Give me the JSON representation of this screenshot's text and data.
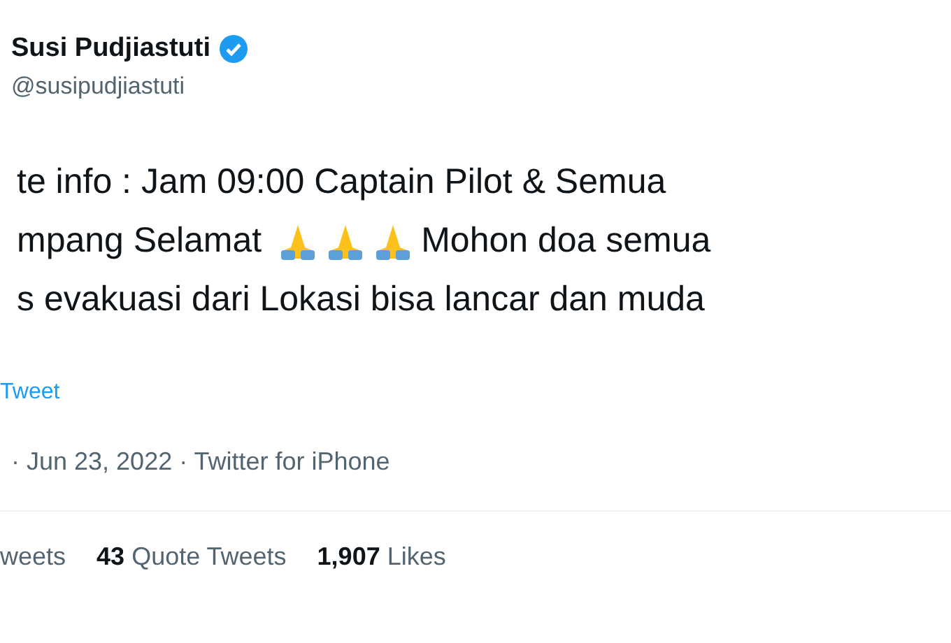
{
  "author": {
    "name": "Susi Pudjiastuti",
    "verified": true,
    "handle": "@susipudjiastuti"
  },
  "tweet_lines": [
    [
      {
        "kind": "text",
        "text": "te info : Jam 09:00 Captain Pilot & Semua"
      }
    ],
    [
      {
        "kind": "text",
        "text": "mpang Selamat"
      },
      {
        "kind": "emoji"
      },
      {
        "kind": "emoji"
      },
      {
        "kind": "emoji"
      },
      {
        "kind": "text",
        "text": "Mohon doa semua"
      }
    ],
    [
      {
        "kind": "text",
        "text": "s evakuasi dari Lokasi bisa lancar dan muda"
      }
    ]
  ],
  "translate_link": "Tweet",
  "meta": "· Jun 23, 2022 · Twitter for iPhone",
  "stats": [
    {
      "label": "weets"
    },
    {
      "count": "43",
      "label": "Quote Tweets"
    },
    {
      "count": "1,907",
      "label": "Likes"
    }
  ]
}
